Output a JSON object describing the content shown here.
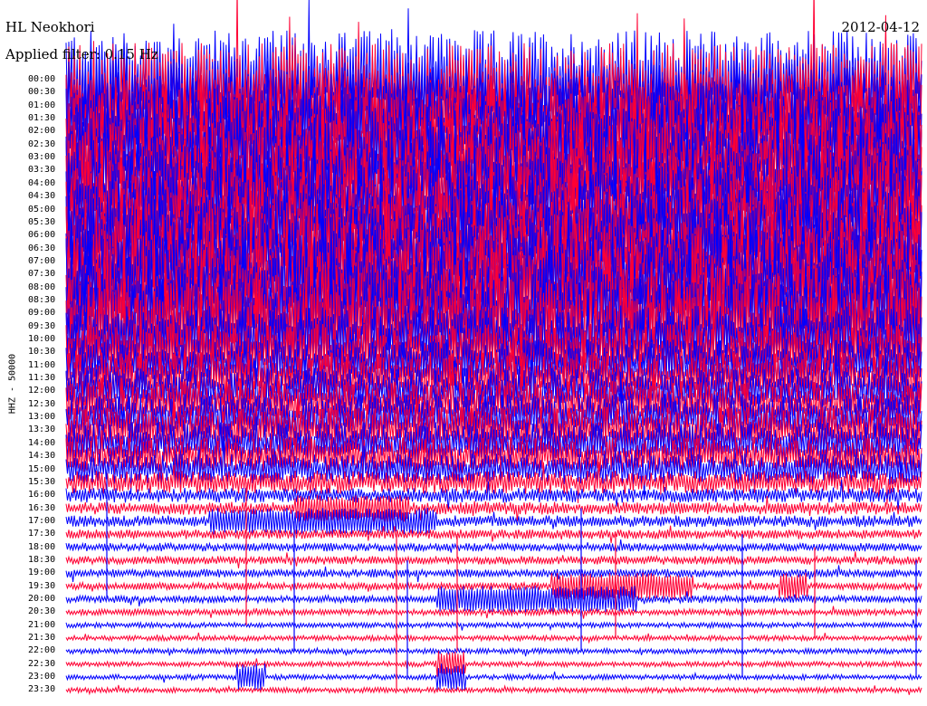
{
  "header": {
    "station": "HL Neokhori",
    "date": "2012-04-12",
    "filter": "Applied filter: 0.15 Hz"
  },
  "chart_data": {
    "type": "line",
    "title": "HL Neokhori",
    "ylabel": "HHZ - 50000",
    "tick_labels": [
      "00:00",
      "00:30",
      "01:00",
      "01:30",
      "02:00",
      "02:30",
      "03:00",
      "03:30",
      "04:00",
      "04:30",
      "05:00",
      "05:30",
      "06:00",
      "06:30",
      "07:00",
      "07:30",
      "08:00",
      "08:30",
      "09:00",
      "09:30",
      "10:00",
      "10:30",
      "11:00",
      "11:30",
      "12:00",
      "12:30",
      "13:00",
      "13:30",
      "14:00",
      "14:30",
      "15:00",
      "15:30",
      "16:00",
      "16:30",
      "17:00",
      "17:30",
      "18:00",
      "18:30",
      "19:00",
      "19:30",
      "20:00",
      "20:30",
      "21:00",
      "21:30",
      "22:00",
      "22:30",
      "23:00",
      "23:30"
    ],
    "trace_colors": [
      "#0000ff",
      "#ff0033"
    ],
    "rows": 48,
    "minutes_per_row": 30,
    "amplitude_by_row": [
      9.5,
      9.5,
      9.5,
      9.5,
      9.5,
      9.5,
      9.5,
      9.5,
      9.5,
      9.5,
      9.5,
      9.5,
      9.5,
      9.5,
      9.5,
      9.5,
      9.5,
      9.5,
      9.5,
      9.5,
      6.5,
      5.5,
      5,
      5,
      4.5,
      4.5,
      4.5,
      4.5,
      4,
      3.5,
      3,
      2.2,
      1.4,
      1.2,
      1.1,
      0.9,
      0.8,
      0.8,
      0.8,
      0.7,
      0.7,
      0.6,
      0.5,
      0.5,
      0.5,
      0.5,
      0.5,
      0.5
    ],
    "events": [
      {
        "time": "16:30",
        "minute_from": 8,
        "minute_to": 12
      },
      {
        "time": "17:00",
        "minute_from": 5,
        "minute_to": 13
      },
      {
        "time": "19:30",
        "minute_from": 17,
        "minute_to": 22
      },
      {
        "time": "19:30",
        "minute_from": 25,
        "minute_to": 26
      },
      {
        "time": "20:00",
        "minute_from": 13,
        "minute_to": 20
      },
      {
        "time": "22:30",
        "minute_from": 13,
        "minute_to": 14
      },
      {
        "time": "23:00",
        "minute_from": 6,
        "minute_to": 7
      },
      {
        "time": "23:00",
        "minute_from": 13,
        "minute_to": 14
      }
    ]
  }
}
